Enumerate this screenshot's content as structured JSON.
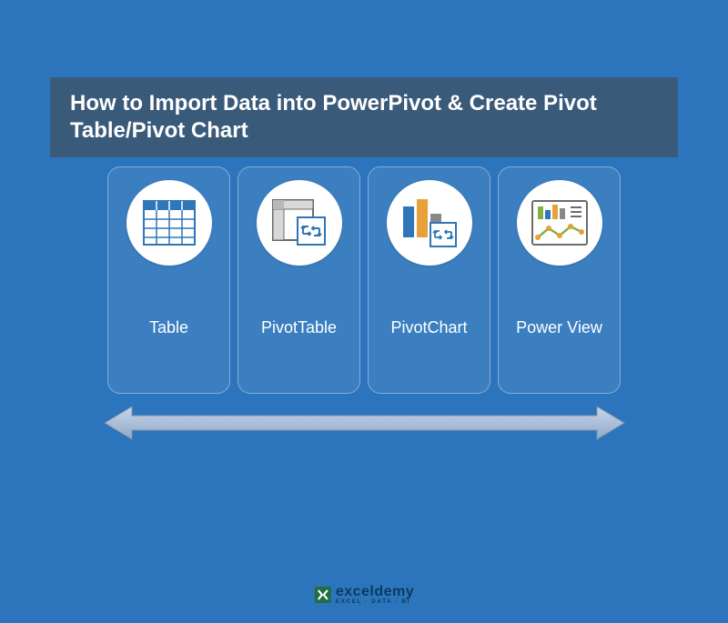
{
  "title": "How to Import Data into PowerPivot & Create Pivot Table/Pivot Chart",
  "cards": [
    {
      "label": "Table"
    },
    {
      "label": "PivotTable"
    },
    {
      "label": "PivotChart"
    },
    {
      "label": "Power View"
    }
  ],
  "logo": {
    "main": "exceldemy",
    "sub": "EXCEL · DATA · BI"
  }
}
